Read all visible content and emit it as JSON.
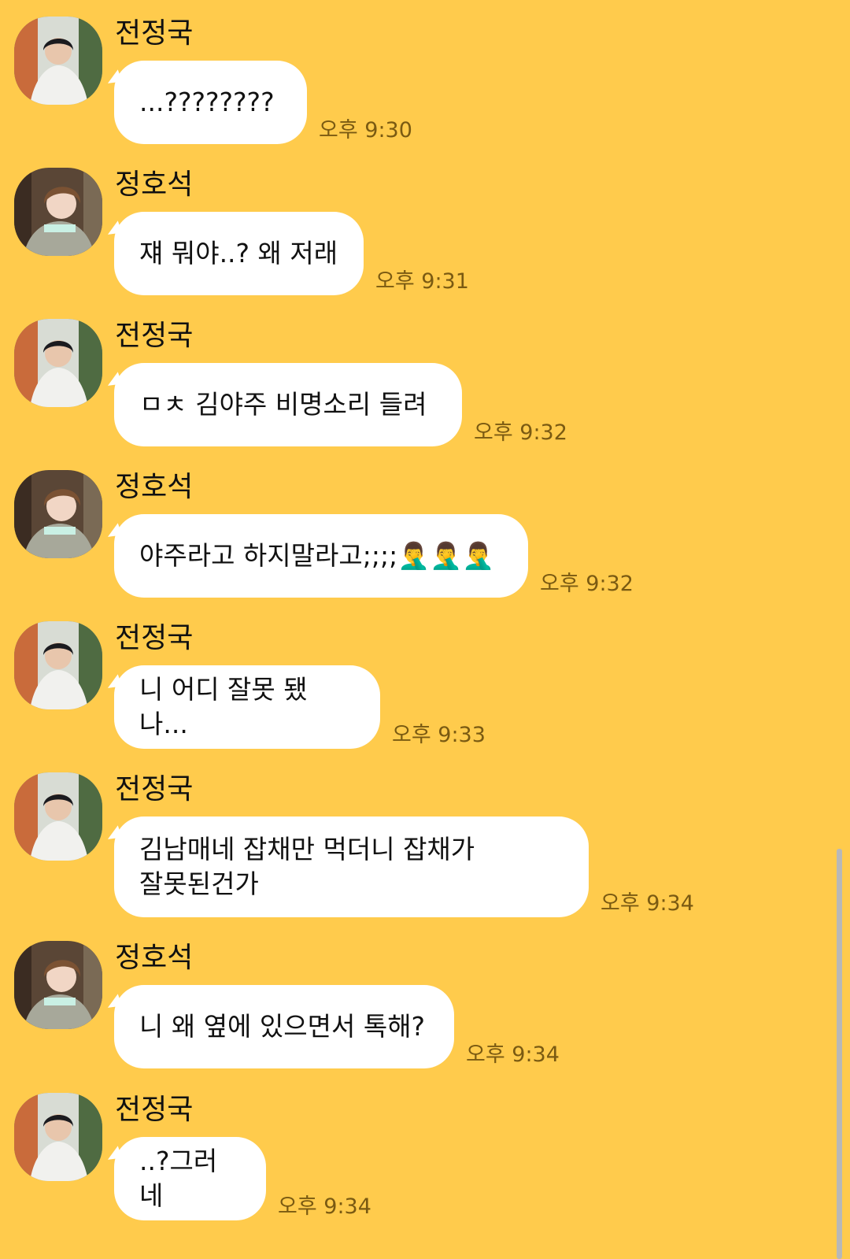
{
  "colors": {
    "background": "#FFCB4C",
    "bubble": "#FFFFFF",
    "timestamp": "#7a5a12"
  },
  "messages": [
    {
      "sender": "전정국",
      "text": "...????????",
      "time": "오후 9:30",
      "avatar": "jungkook-avatar"
    },
    {
      "sender": "정호석",
      "text": "쟤 뭐야..? 왜 저래",
      "time": "오후 9:31",
      "avatar": "hoseok-avatar"
    },
    {
      "sender": "전정국",
      "text": "ㅁㅊ 김야주 비명소리 들려",
      "time": "오후 9:32",
      "avatar": "jungkook-avatar"
    },
    {
      "sender": "정호석",
      "text": "야주라고 하지말라고;;;;🤦‍♂️🤦‍♂️🤦‍♂️",
      "time": "오후 9:32",
      "avatar": "hoseok-avatar"
    },
    {
      "sender": "전정국",
      "text": "니 어디 잘못 됐나...",
      "time": "오후 9:33",
      "avatar": "jungkook-avatar"
    },
    {
      "sender": "전정국",
      "text": "김남매네 잡채만 먹더니 잡채가\n잘못된건가",
      "time": "오후 9:34",
      "avatar": "jungkook-avatar"
    },
    {
      "sender": "정호석",
      "text": "니 왜 옆에 있으면서 톡해?",
      "time": "오후 9:34",
      "avatar": "hoseok-avatar"
    },
    {
      "sender": "전정국",
      "text": "..?그러네",
      "time": "오후 9:34",
      "avatar": "jungkook-avatar"
    }
  ]
}
